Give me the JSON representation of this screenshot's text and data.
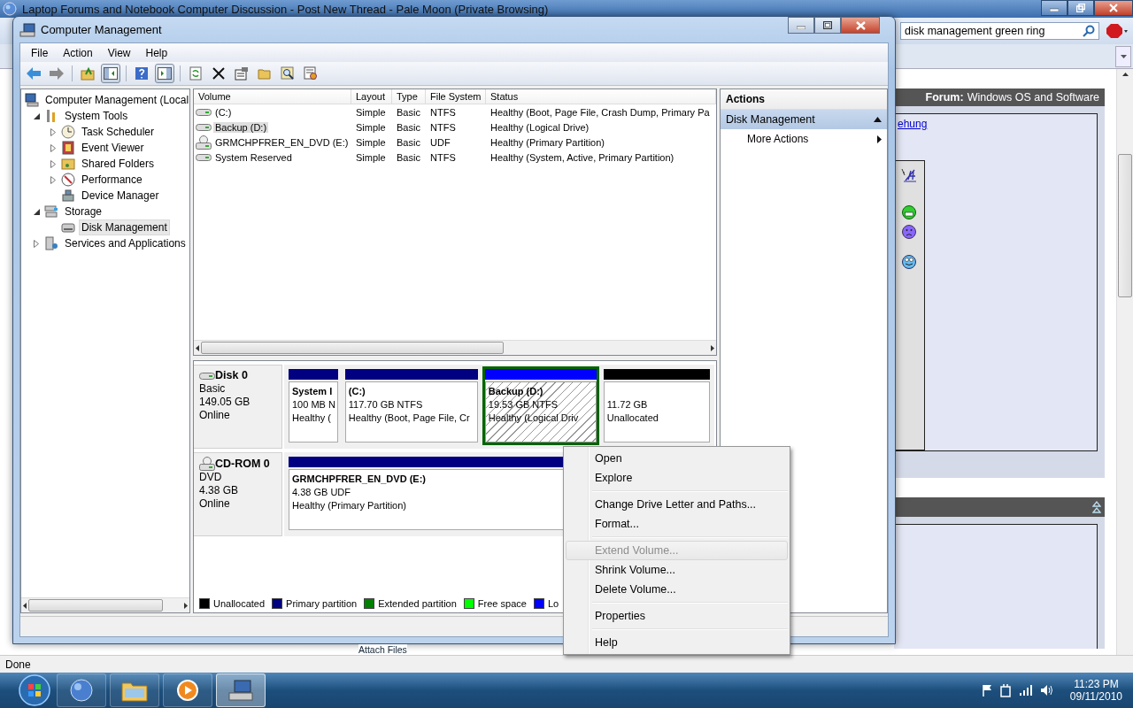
{
  "browser": {
    "title": "Laptop Forums and Notebook Computer Discussion - Post New Thread - Pale Moon (Private Browsing)",
    "search": {
      "value": "disk management green ring"
    },
    "forum_header": {
      "label": "Forum:",
      "value": "Windows OS and Software"
    },
    "link": "ehung",
    "attach_label": "Attach Files",
    "status": "Done"
  },
  "window": {
    "title": "Computer Management",
    "menu": [
      "File",
      "Action",
      "View",
      "Help"
    ],
    "toolbar": {
      "console_tree_shown": true,
      "action_pane_shown": true
    }
  },
  "tree": [
    {
      "label": "Computer Management (Local",
      "selected": false,
      "children": [
        {
          "label": "System Tools",
          "expanded": true,
          "selected": false,
          "children": [
            {
              "label": "Task Scheduler",
              "expanded": false,
              "selected": false
            },
            {
              "label": "Event Viewer",
              "expanded": false,
              "selected": false
            },
            {
              "label": "Shared Folders",
              "expanded": false,
              "selected": false
            },
            {
              "label": "Performance",
              "expanded": false,
              "selected": false
            },
            {
              "label": "Device Manager",
              "selected": false
            }
          ]
        },
        {
          "label": "Storage",
          "expanded": true,
          "selected": false,
          "children": [
            {
              "label": "Disk Management",
              "selected": true
            }
          ]
        },
        {
          "label": "Services and Applications",
          "expanded": false,
          "selected": false
        }
      ]
    }
  ],
  "volumes": {
    "columns": [
      "Volume",
      "Layout",
      "Type",
      "File System",
      "Status"
    ],
    "rows": [
      {
        "kind": "disk",
        "selected": false,
        "cells": [
          "(C:)",
          "Simple",
          "Basic",
          "NTFS",
          "Healthy (Boot, Page File, Crash Dump, Primary Pa"
        ]
      },
      {
        "kind": "disk",
        "selected": true,
        "cells": [
          "Backup (D:)",
          "Simple",
          "Basic",
          "NTFS",
          "Healthy (Logical Drive)"
        ]
      },
      {
        "kind": "cd",
        "selected": false,
        "cells": [
          "GRMCHPFRER_EN_DVD (E:)",
          "Simple",
          "Basic",
          "UDF",
          "Healthy (Primary Partition)"
        ]
      },
      {
        "kind": "disk",
        "selected": false,
        "cells": [
          "System Reserved",
          "Simple",
          "Basic",
          "NTFS",
          "Healthy (System, Active, Primary Partition)"
        ]
      }
    ]
  },
  "disks": [
    {
      "name": "Disk 0",
      "kind": "disk",
      "type": "Basic",
      "size": "149.05 GB",
      "state": "Online",
      "partitions": [
        {
          "name": "System I",
          "size": "100 MB N",
          "status": "Healthy (",
          "color": "#000080",
          "selected": false
        },
        {
          "name": "(C:)",
          "size": "117.70 GB NTFS",
          "status": "Healthy (Boot, Page File, Cr",
          "color": "#000080",
          "selected": false
        },
        {
          "name": "Backup  (D:)",
          "size": "19.53 GB NTFS",
          "status": "Healthy (Logical Driv",
          "color": "#0000ff",
          "selected": true
        },
        {
          "size": "11.72 GB",
          "status": "Unallocated",
          "color": "#000000",
          "selected": false
        }
      ]
    },
    {
      "name": "CD-ROM 0",
      "kind": "cd",
      "type": "DVD",
      "size": "4.38 GB",
      "state": "Online",
      "partitions": [
        {
          "name": "GRMCHPFRER_EN_DVD  (E:)",
          "size": "4.38 GB UDF",
          "status": "Healthy (Primary Partition)",
          "color": "#000080",
          "selected": false
        }
      ]
    }
  ],
  "legend": [
    {
      "label": "Unallocated",
      "color": "#000000"
    },
    {
      "label": "Primary partition",
      "color": "#000080"
    },
    {
      "label": "Extended partition",
      "color": "#008000"
    },
    {
      "label": "Free space",
      "color": "#00ff00"
    },
    {
      "label": "Lo",
      "color": "#0000ff"
    }
  ],
  "actions": {
    "title": "Actions",
    "sections": [
      {
        "label": "Disk Management",
        "expanded": true,
        "items": [
          "More Actions"
        ]
      }
    ]
  },
  "context_menu": [
    {
      "kind": "item",
      "label": "Open",
      "disabled": false,
      "highlighted": false
    },
    {
      "kind": "item",
      "label": "Explore",
      "disabled": false,
      "highlighted": false
    },
    {
      "kind": "separator"
    },
    {
      "kind": "item",
      "label": "Change Drive Letter and Paths...",
      "disabled": false,
      "highlighted": false
    },
    {
      "kind": "item",
      "label": "Format...",
      "disabled": false,
      "highlighted": false
    },
    {
      "kind": "separator"
    },
    {
      "kind": "item",
      "label": "Extend Volume...",
      "disabled": true,
      "highlighted": true
    },
    {
      "kind": "item",
      "label": "Shrink Volume...",
      "disabled": false,
      "highlighted": false
    },
    {
      "kind": "item",
      "label": "Delete Volume...",
      "disabled": false,
      "highlighted": false
    },
    {
      "kind": "separator"
    },
    {
      "kind": "item",
      "label": "Properties",
      "disabled": false,
      "highlighted": false
    },
    {
      "kind": "separator"
    },
    {
      "kind": "item",
      "label": "Help",
      "disabled": false,
      "highlighted": false
    }
  ],
  "taskbar": {
    "buttons": [
      {
        "selected": false
      },
      {
        "selected": false
      },
      {
        "selected": false
      },
      {
        "selected": true
      }
    ],
    "clock": {
      "time": "11:23 PM",
      "date": "09/11/2010"
    }
  }
}
